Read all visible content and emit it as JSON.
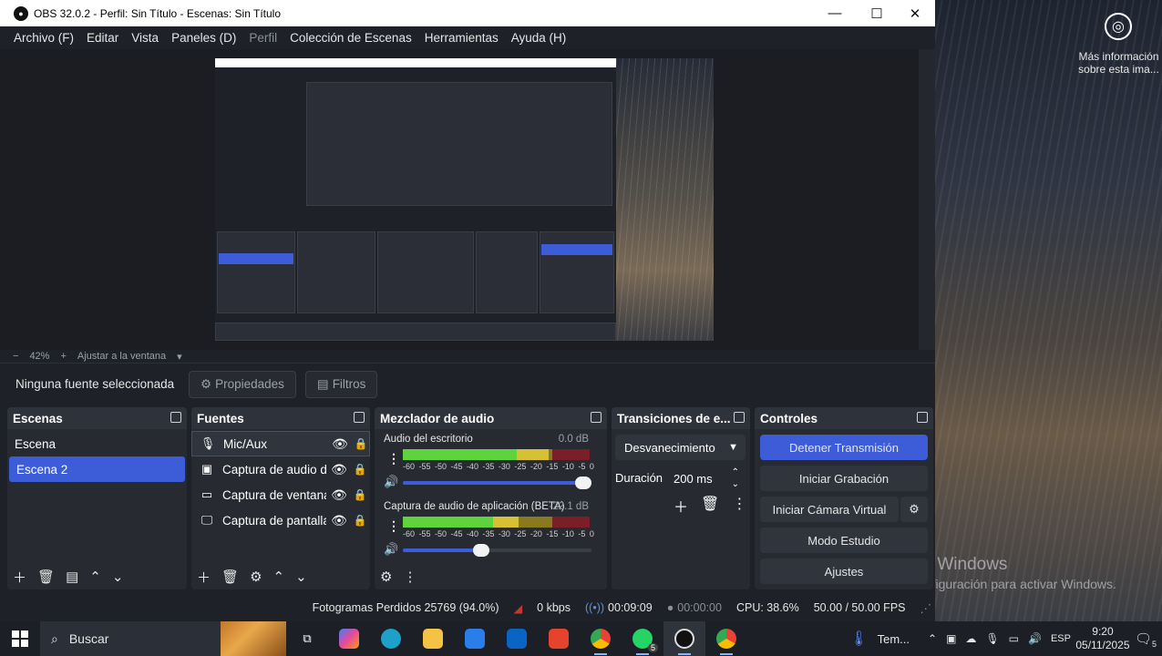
{
  "desktop": {
    "info_text": "Más información sobre esta ima...",
    "watermark_title": "Activar Windows",
    "watermark_sub": "Ve a Configuración para activar Windows."
  },
  "window": {
    "title": "OBS 32.0.2 - Perfil: Sin Título - Escenas: Sin Título",
    "minimize": "—",
    "maximize": "☐",
    "close": "✕"
  },
  "menu": [
    "Archivo (F)",
    "Editar",
    "Vista",
    "Paneles (D)",
    "Perfil",
    "Colección de Escenas",
    "Herramientas",
    "Ayuda (H)"
  ],
  "zoom": {
    "minus": "−",
    "value": "42%",
    "plus": "+",
    "fit": "Ajustar a la ventana"
  },
  "source_toolbar": {
    "no_source": "Ninguna fuente seleccionada",
    "properties": "Propiedades",
    "filters": "Filtros"
  },
  "scenes": {
    "title": "Escenas",
    "items": [
      "Escena",
      "Escena 2"
    ],
    "selected": "Escena 2"
  },
  "sources": {
    "title": "Fuentes",
    "items": [
      {
        "label": "Mic/Aux",
        "icon": "mic-icon"
      },
      {
        "label": "Captura de audio de aplicación",
        "icon": "speaker-icon"
      },
      {
        "label": "Captura de ventana",
        "icon": "window-icon"
      },
      {
        "label": "Captura de pantalla",
        "icon": "monitor-icon"
      }
    ]
  },
  "mixer": {
    "title": "Mezclador de audio",
    "channels": [
      {
        "name": "Audio del escritorio",
        "db": "0.0 dB",
        "level": 0.78,
        "volume": 1.0
      },
      {
        "name": "Captura de audio de aplicación (BETA)",
        "db": "-22.1 dB",
        "level": 0.62,
        "volume": 0.46
      }
    ],
    "ticks": [
      "-60",
      "-55",
      "-50",
      "-45",
      "-40",
      "-35",
      "-30",
      "-25",
      "-20",
      "-15",
      "-10",
      "-5",
      "0"
    ]
  },
  "transitions": {
    "title": "Transiciones de e...",
    "selected": "Desvanecimiento",
    "duration_label": "Duración",
    "duration_value": "200 ms"
  },
  "controls": {
    "title": "Controles",
    "stop_stream": "Detener Transmisión",
    "start_recording": "Iniciar Grabación",
    "start_virtual_cam": "Iniciar Cámara Virtual",
    "studio_mode": "Modo Estudio",
    "settings": "Ajustes"
  },
  "status": {
    "dropped_frames": "Fotogramas Perdidos 25769 (94.0%)",
    "bitrate": "0 kbps",
    "stream_time": "00:09:09",
    "rec_time": "00:00:00",
    "cpu": "CPU: 38.6%",
    "fps": "50.00 / 50.00 FPS"
  },
  "taskbar": {
    "search_placeholder": "Buscar",
    "weather": "Tem...",
    "language": "ESP",
    "time": "9:20",
    "date": "05/11/2025",
    "notifications": "5",
    "whatsapp_badge": "5"
  },
  "colors": {
    "accent": "#3c5cd8",
    "panel": "#272a31",
    "background": "#1e2127"
  }
}
